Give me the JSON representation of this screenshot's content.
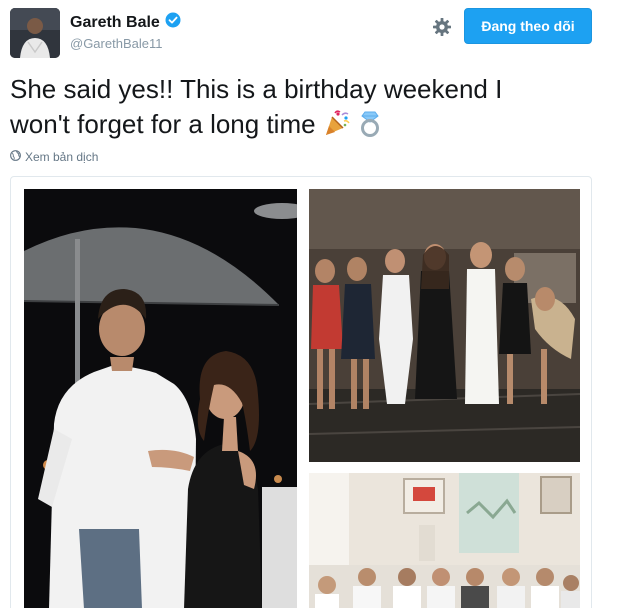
{
  "profile": {
    "display_name": "Gareth Bale",
    "handle": "@GarethBale11",
    "verified": true
  },
  "actions": {
    "follow_label": "Đang theo dõi"
  },
  "tweet": {
    "text_line1": "She said yes!! This is a birthday weekend I",
    "text_line2": "won't forget for a long time",
    "emojis": [
      "party-popper-icon",
      "ring-icon"
    ],
    "translate_label": "Xem bản dịch"
  },
  "colors": {
    "accent": "#1da1f2",
    "text": "#14171a",
    "secondary": "#657786"
  }
}
